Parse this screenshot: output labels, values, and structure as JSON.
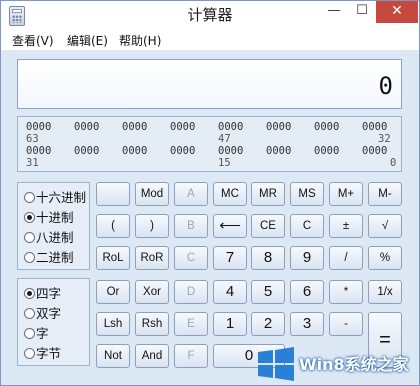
{
  "window": {
    "title": "计算器",
    "close_glyph": "✕",
    "minimize_glyph": "—",
    "maximize_glyph": "☐"
  },
  "menu": [
    "查看(V)",
    "编辑(E)",
    "帮助(H)"
  ],
  "display": {
    "value": "0"
  },
  "bits": {
    "row1_groups": [
      "0000",
      "0000",
      "0000",
      "0000",
      "0000",
      "0000",
      "0000",
      "0000"
    ],
    "row1_positions": [
      "63",
      "47",
      "32"
    ],
    "row2_groups": [
      "0000",
      "0000",
      "0000",
      "0000",
      "0000",
      "0000",
      "0000",
      "0000"
    ],
    "row2_positions": [
      "31",
      "15",
      "0"
    ]
  },
  "base_options": [
    {
      "label": "十六进制",
      "checked": false
    },
    {
      "label": "十进制",
      "checked": true
    },
    {
      "label": "八进制",
      "checked": false
    },
    {
      "label": "二进制",
      "checked": false
    }
  ],
  "word_options": [
    {
      "label": "四字",
      "checked": true
    },
    {
      "label": "双字",
      "checked": false
    },
    {
      "label": "字",
      "checked": false
    },
    {
      "label": "字节",
      "checked": false
    }
  ],
  "keys": {
    "blank": "",
    "mod": "Mod",
    "a": "A",
    "mc": "MC",
    "mr": "MR",
    "ms": "MS",
    "mplus": "M+",
    "mminus": "M-",
    "lparen": "(",
    "rparen": ")",
    "b": "B",
    "back": "⟵",
    "ce": "CE",
    "c": "C",
    "plusminus": "±",
    "sqrt": "√",
    "rol": "RoL",
    "ror": "RoR",
    "c_hex": "C",
    "seven": "7",
    "eight": "8",
    "nine": "9",
    "div": "/",
    "pct": "%",
    "or": "Or",
    "xor": "Xor",
    "d": "D",
    "four": "4",
    "five": "5",
    "six": "6",
    "mul": "*",
    "recip": "1/x",
    "lsh": "Lsh",
    "rsh": "Rsh",
    "e": "E",
    "one": "1",
    "two": "2",
    "three": "3",
    "sub": "-",
    "eq": "=",
    "not": "Not",
    "and": "And",
    "f": "F",
    "zero": "0"
  },
  "watermark": {
    "text": "Win8系统之家"
  },
  "colors": {
    "close_red": "#c7483e",
    "window_bg": "#dde8f5",
    "watermark_blue": "#1b5fa8"
  }
}
